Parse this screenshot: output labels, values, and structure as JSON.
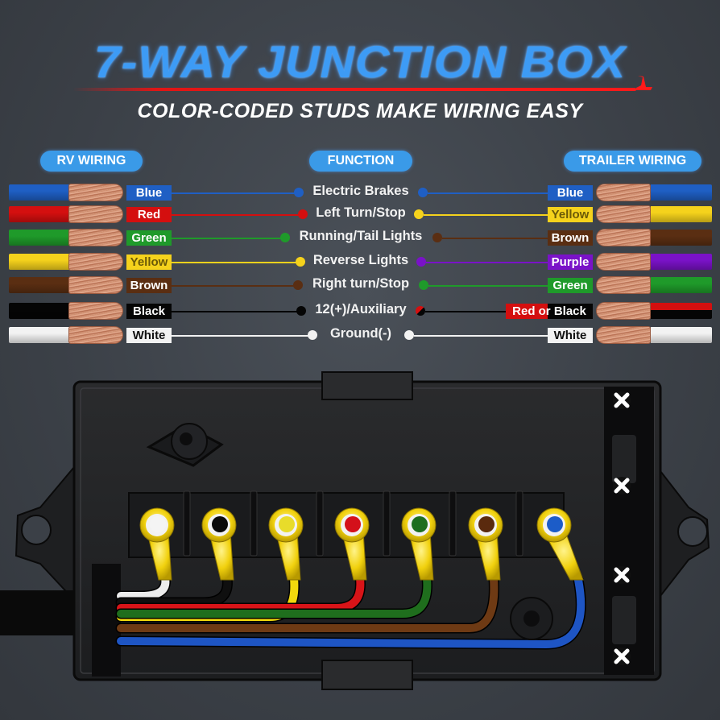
{
  "header": {
    "title": "7-WAY JUNCTION BOX",
    "subtitle": "COLOR-CODED STUDS MAKE WIRING EASY"
  },
  "columns": {
    "rv": "RV WIRING",
    "function": "FUNCTION",
    "trailer": "TRAILER WIRING"
  },
  "rows": [
    {
      "rv": "Blue",
      "rv_color": "#1f5fc4",
      "function": "Electric Brakes",
      "trailer": "Blue",
      "trailer_color": "#1f5fc4"
    },
    {
      "rv": "Red",
      "rv_color": "#d40f0f",
      "function": "Left Turn/Stop",
      "trailer": "Yellow",
      "trailer_color": "#f5d21c"
    },
    {
      "rv": "Green",
      "rv_color": "#1f9a2a",
      "function": "Running/Tail Lights",
      "trailer": "Brown",
      "trailer_color": "#5a2e12"
    },
    {
      "rv": "Yellow",
      "rv_color": "#f5d21c",
      "function": "Reverse Lights",
      "trailer": "Purple",
      "trailer_color": "#7a12c8"
    },
    {
      "rv": "Brown",
      "rv_color": "#5a2e12",
      "function": "Right turn/Stop",
      "trailer": "Green",
      "trailer_color": "#1f9a2a"
    },
    {
      "rv": "Black",
      "rv_color": "#050505",
      "function": "12(+)/Auxiliary",
      "trailer": "Red or Black",
      "trailer_color": "#050505",
      "trailer_alt_color": "#d40f0f"
    },
    {
      "rv": "White",
      "rv_color": "#f2f2f2",
      "function": "Ground(-)",
      "trailer": "White",
      "trailer_color": "#f2f2f2"
    }
  ],
  "colors": {
    "accent_blue": "#3a9ae8",
    "title_blue": "#3d9bf5",
    "underline_red": "#e01515",
    "background": "#3b4047"
  },
  "box": {
    "studs": [
      {
        "color": "White"
      },
      {
        "color": "Black"
      },
      {
        "color": "Yellow"
      },
      {
        "color": "Red"
      },
      {
        "color": "Green"
      },
      {
        "color": "Brown"
      },
      {
        "color": "Blue"
      }
    ]
  }
}
